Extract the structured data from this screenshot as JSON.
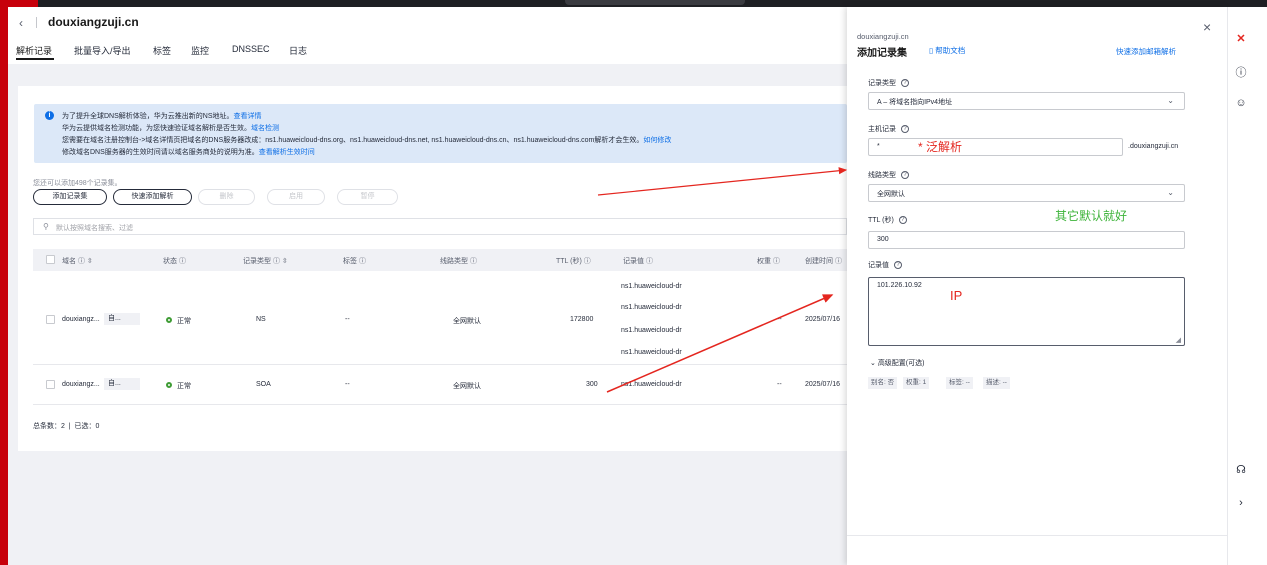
{
  "topbar": {},
  "header": {
    "back_icon": "‹",
    "title": "douxiangzuji.cn",
    "tabs": [
      "解析记录",
      "批量导入/导出",
      "标签",
      "监控",
      "DNSSEC",
      "日志"
    ]
  },
  "notice": {
    "line1": "为了提升全球DNS解析体验，华为云推出新的NS地址。",
    "line1_link": "查看详情",
    "line2": "华为云提供域名检测功能，为您快速验证域名解析是否生效。",
    "line2_link": "域名检测",
    "line3": "您需要在域名注册控制台->域名详情页把域名的DNS服务器改成：ns1.huaweicloud-dns.org、ns1.huaweicloud-dns.net, ns1.huaweicloud-dns.cn、ns1.huaweicloud-dns.com解析才会生效。",
    "line3_link": "如何修改",
    "line4": "修改域名DNS服务器的生效时间请以域名服务商处的说明为准。",
    "line4_link": "查看解析生效时间"
  },
  "toolbar": {
    "quota": "您还可以添加498个记录集。",
    "add": "添加记录集",
    "quick_add": "快速添加解析",
    "delete": "删除",
    "enable": "启用",
    "pause": "暂停",
    "search_placeholder": "默认按照域名搜索、过滤"
  },
  "table": {
    "headers": {
      "domain": "域名 ⓘ ⇳",
      "status": "状态 ⓘ",
      "type": "记录类型 ⓘ ⇳",
      "tag": "标签 ⓘ",
      "line": "线路类型 ⓘ",
      "ttl": "TTL (秒) ⓘ",
      "value": "记录值 ⓘ",
      "weight": "权重 ⓘ",
      "created": "创建时间 ⓘ"
    },
    "rows": [
      {
        "domain": "douxiangz...",
        "domain_tag": "自...",
        "status": "正常",
        "type": "NS",
        "tag": "--",
        "line": "全网默认",
        "ttl": "172800",
        "values": [
          "ns1.huaweicloud-dr",
          "ns1.huaweicloud-dr",
          "ns1.huaweicloud-dr",
          "ns1.huaweicloud-dr"
        ],
        "weight": "--",
        "created": "2025/07/16"
      },
      {
        "domain": "douxiangz...",
        "domain_tag": "自...",
        "status": "正常",
        "type": "SOA",
        "tag": "--",
        "line": "全网默认",
        "ttl": "300",
        "values": [
          "ns1.huaweicloud-dr"
        ],
        "weight": "--",
        "created": "2025/07/16"
      }
    ],
    "total": "总条数：2",
    "selected": "已选：0"
  },
  "drawer": {
    "subtitle": "douxiangzuji.cn",
    "title": "添加记录集",
    "help": "帮助文档",
    "quick_mail": "快速添加邮箱解析",
    "record_type_label": "记录类型",
    "record_type_value": "A – 将域名指向IPv4地址",
    "host_label": "主机记录",
    "host_value": "*",
    "host_suffix": ".douxiangzuji.cn",
    "line_label": "线路类型",
    "line_value": "全网默认",
    "ttl_label": "TTL (秒)",
    "ttl_value": "300",
    "value_label": "记录值",
    "value_value": "101.226.10.92",
    "advanced": "高级配置(可选)",
    "adv_tags": [
      "别名: 否",
      "权重: 1",
      "标签: --",
      "描述: --"
    ]
  },
  "annotations": {
    "wildcard": "* 泛解析",
    "others_default": "其它默认就好",
    "ip": "IP"
  },
  "colors": {
    "accent": "#0d6ee6",
    "brand": "#c7000b",
    "annotation": "#e4261f",
    "annotation_green": "#3fb43b"
  }
}
